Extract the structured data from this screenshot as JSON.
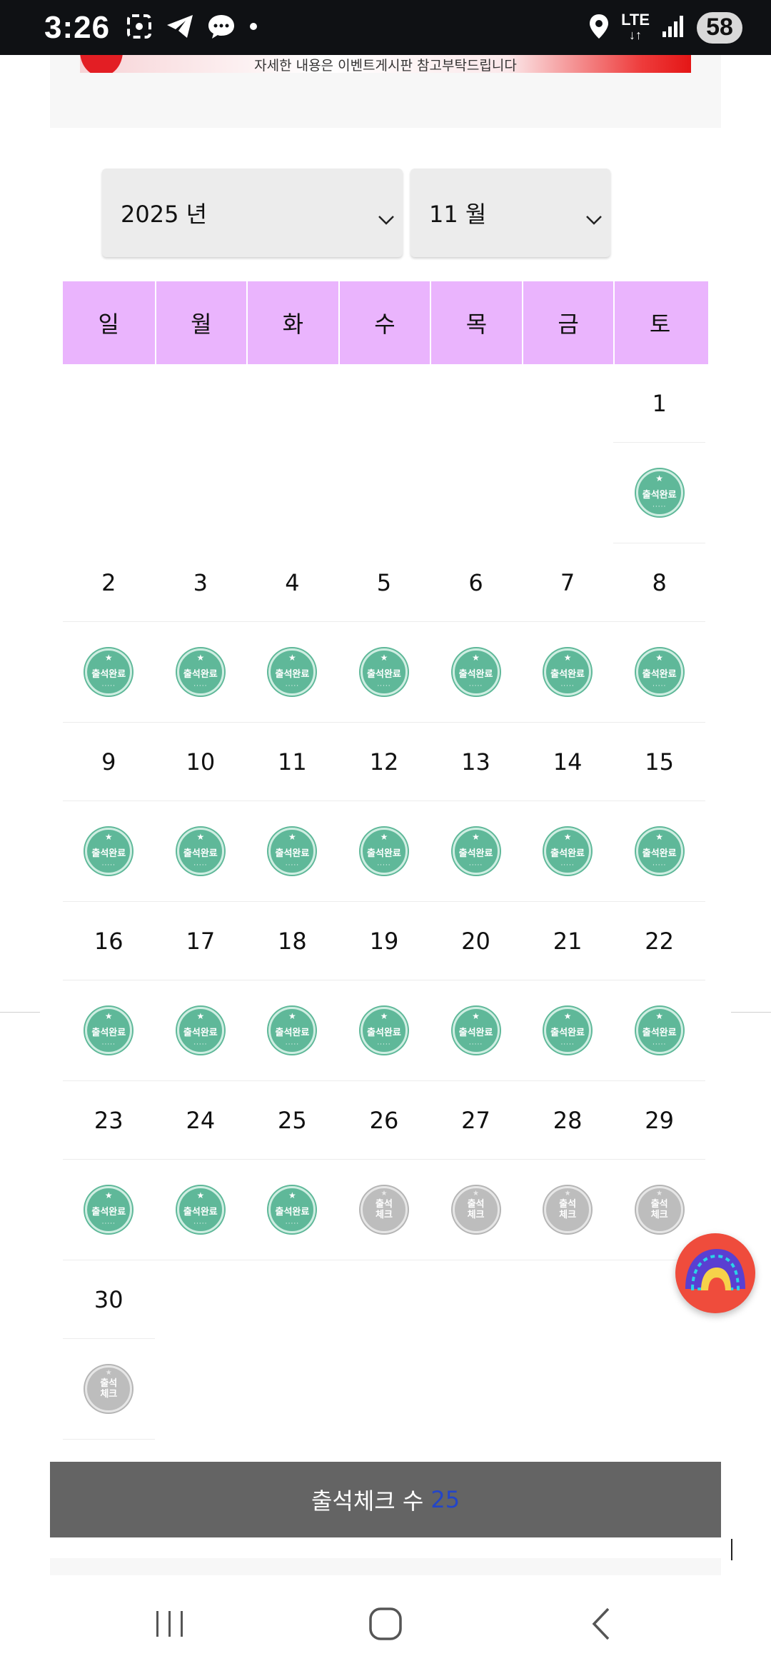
{
  "status_bar": {
    "time": "3:26",
    "network": "LTE",
    "battery": "58",
    "icons": [
      "gallery-icon",
      "telegram-icon",
      "message-icon",
      "dot-icon",
      "location-icon",
      "signal-icon"
    ]
  },
  "banner": {
    "text": "자세한 내용은 이벤트게시판 참고부탁드립니다"
  },
  "selects": {
    "year": "2025 년",
    "month": "11 월"
  },
  "calendar": {
    "weekdays": [
      "일",
      "월",
      "화",
      "수",
      "목",
      "금",
      "토"
    ],
    "stamp_done_label": "출석완료",
    "stamp_pending_label": "출석체크",
    "weeks": [
      {
        "dates": [
          "",
          "",
          "",
          "",
          "",
          "",
          "1"
        ],
        "stamps": [
          "",
          "",
          "",
          "",
          "",
          "",
          "done"
        ]
      },
      {
        "dates": [
          "2",
          "3",
          "4",
          "5",
          "6",
          "7",
          "8"
        ],
        "stamps": [
          "done",
          "done",
          "done",
          "done",
          "done",
          "done",
          "done"
        ]
      },
      {
        "dates": [
          "9",
          "10",
          "11",
          "12",
          "13",
          "14",
          "15"
        ],
        "stamps": [
          "done",
          "done",
          "done",
          "done",
          "done",
          "done",
          "done"
        ]
      },
      {
        "dates": [
          "16",
          "17",
          "18",
          "19",
          "20",
          "21",
          "22"
        ],
        "stamps": [
          "done",
          "done",
          "done",
          "done",
          "done",
          "done",
          "done"
        ]
      },
      {
        "dates": [
          "23",
          "24",
          "25",
          "26",
          "27",
          "28",
          "29"
        ],
        "stamps": [
          "done",
          "done",
          "done",
          "pending",
          "pending",
          "pending",
          "pending"
        ]
      },
      {
        "dates": [
          "30",
          "",
          "",
          "",
          "",
          "",
          ""
        ],
        "stamps": [
          "pending",
          "",
          "",
          "",
          "",
          "",
          ""
        ]
      }
    ]
  },
  "summary": {
    "label": "출석체크 수",
    "count": "25"
  },
  "colors": {
    "header_bg": "#eab4fd",
    "stamp_done": "#5fb899",
    "stamp_pending": "#bdbdbd",
    "count_bar": "#646464",
    "count_number": "#2345c8"
  }
}
